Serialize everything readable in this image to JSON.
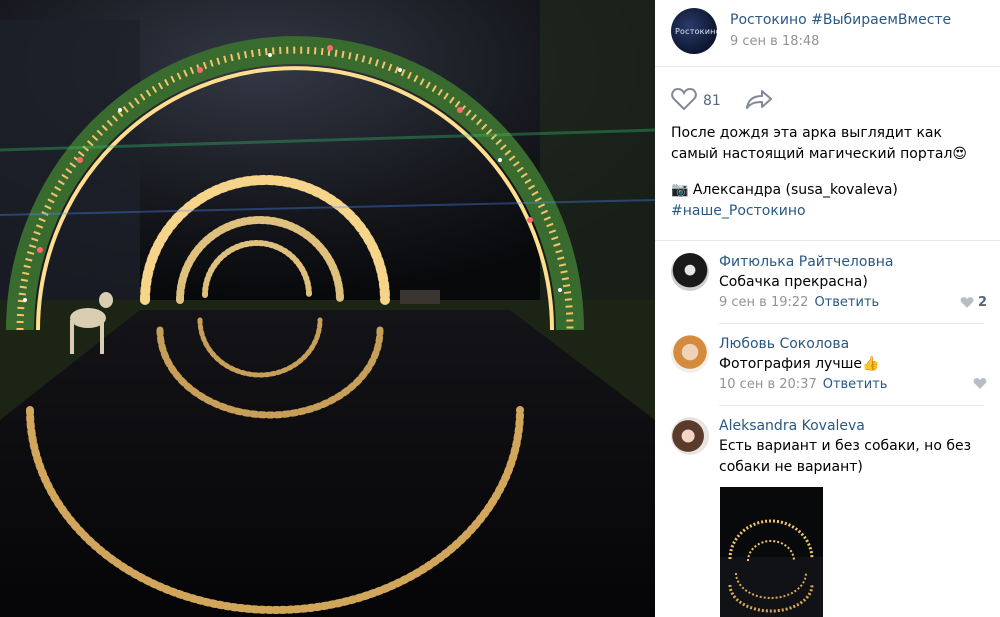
{
  "post": {
    "author_name": "Ростокино #ВыбираемВместе",
    "date": "9 сен в 18:48",
    "avatar_caption": "Ростокино",
    "likes": "81",
    "text": "После дождя эта арка выглядит как самый настоящий магический портал😍",
    "credit": "📷 Александра (susa_kovaleva)",
    "hashtag": "#наше_Ростокино"
  },
  "comments": [
    {
      "name": "Фитюлька Райтчеловна",
      "text": "Собачка прекрасна)",
      "date": "9 сен в 19:22",
      "reply_label": "Ответить",
      "likes": "2"
    },
    {
      "name": "Любовь Соколова",
      "text": "Фотография лучше👍",
      "date": "10 сен в 20:37",
      "reply_label": "Ответить",
      "likes": ""
    },
    {
      "name": "Aleksandra Kovaleva",
      "text": "Есть вариант и без собаки, но без собаки не вариант)",
      "date": "",
      "reply_label": "",
      "likes": ""
    }
  ],
  "icons": {
    "like": "heart-icon",
    "share": "share-arrow-icon",
    "camera": "camera-icon"
  },
  "colors": {
    "link": "#2a5885",
    "meta": "#939393",
    "photo_bg": "#0b0b0d",
    "light_arch": "#f4c46a"
  }
}
